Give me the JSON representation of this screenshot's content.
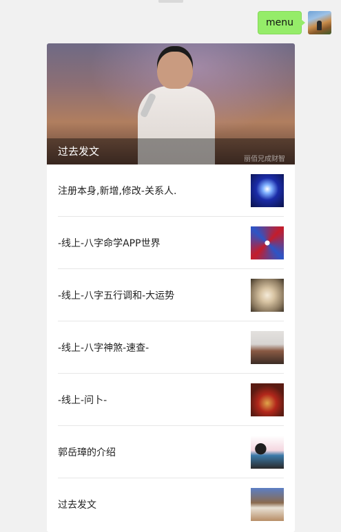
{
  "chat": {
    "message": "menu",
    "avatar_icon": "user-avatar"
  },
  "article_card": {
    "cover_caption": "过去发文",
    "cover_watermark": "丽佰兄成财智",
    "items": [
      {
        "title": "注册本身,新增,修改-关系人.",
        "thumb_icon": "zodiac-thumbnail"
      },
      {
        "title": "-线上-八字命学APP世界",
        "thumb_icon": "mandala-thumbnail"
      },
      {
        "title": "-线上-八字五行调和-大运势",
        "thumb_icon": "chandelier-thumbnail"
      },
      {
        "title": "-线上-八字神煞-速查-",
        "thumb_icon": "room-thumbnail"
      },
      {
        "title": "-线上-问卜-",
        "thumb_icon": "table-thumbnail"
      },
      {
        "title": "郭岳璋的介绍",
        "thumb_icon": "portrait-thumbnail"
      },
      {
        "title": "过去发文",
        "thumb_icon": "speaker-thumbnail"
      }
    ]
  }
}
